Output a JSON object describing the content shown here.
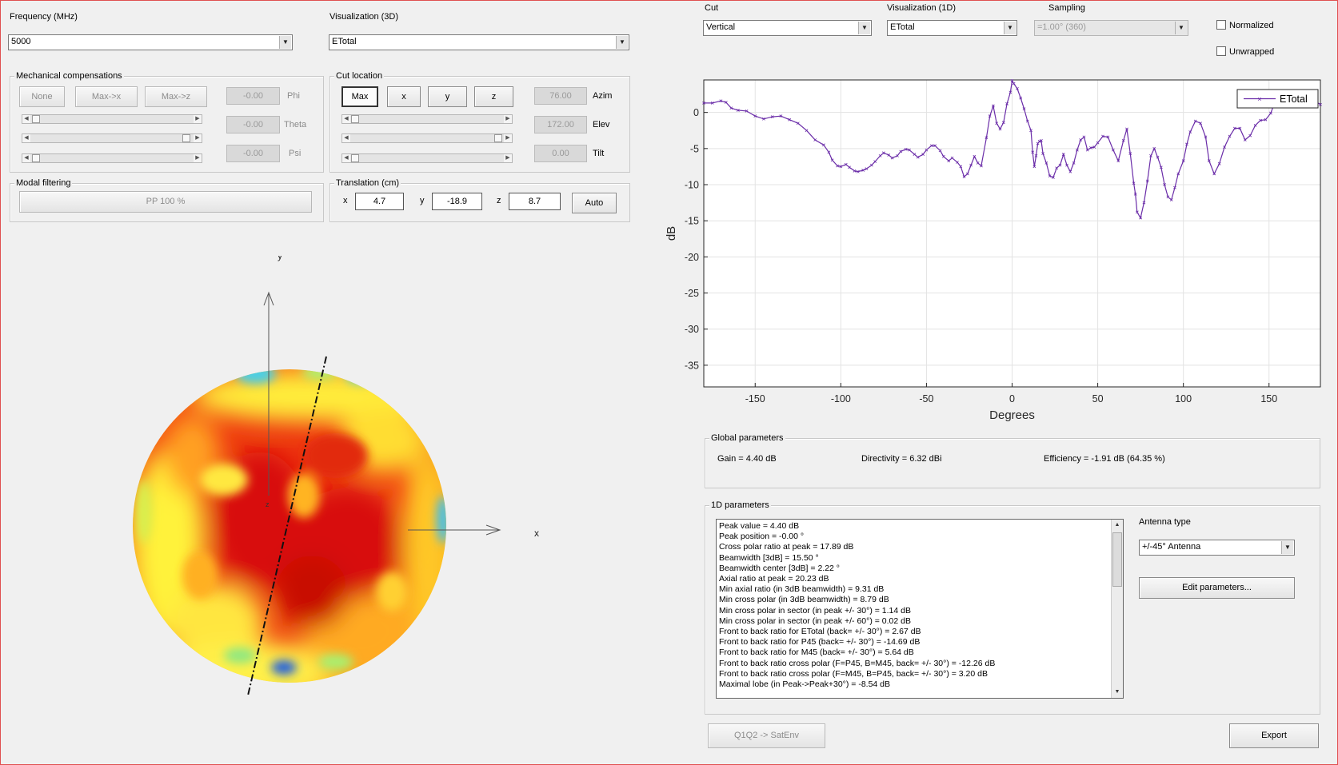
{
  "left": {
    "frequency": {
      "label": "Frequency (MHz)",
      "value": "5000"
    },
    "viz3d": {
      "label": "Visualization (3D)",
      "value": "ETotal"
    },
    "mech": {
      "title": "Mechanical compensations",
      "buttons": [
        "None",
        "Max->x",
        "Max->z"
      ],
      "fields": [
        {
          "value": "-0.00",
          "label": "Phi"
        },
        {
          "value": "-0.00",
          "label": "Theta"
        },
        {
          "value": "-0.00",
          "label": "Psi"
        }
      ]
    },
    "cutloc": {
      "title": "Cut location",
      "buttons": [
        "Max",
        "x",
        "y",
        "z"
      ],
      "fields": [
        {
          "value": "76.00",
          "label": "Azim"
        },
        {
          "value": "172.00",
          "label": "Elev"
        },
        {
          "value": "0.00",
          "label": "Tilt"
        }
      ]
    },
    "modal": {
      "title": "Modal filtering",
      "button": "PP 100 %"
    },
    "translation": {
      "title": "Translation (cm)",
      "x_label": "x",
      "x": "4.7",
      "y_label": "y",
      "y": "-18.9",
      "z_label": "z",
      "z": "8.7",
      "auto": "Auto"
    },
    "sphere_axes": {
      "y": "y",
      "x": "x",
      "z": "z"
    }
  },
  "right": {
    "cut": {
      "label": "Cut",
      "value": "Vertical"
    },
    "viz1d": {
      "label": "Visualization (1D)",
      "value": "ETotal"
    },
    "sampling": {
      "label": "Sampling",
      "value": "=1.00° (360)"
    },
    "normalized": {
      "label": "Normalized",
      "checked": false
    },
    "unwrapped": {
      "label": "Unwrapped",
      "checked": false
    },
    "global": {
      "title": "Global parameters",
      "gain": "Gain = 4.40 dB",
      "directivity": "Directivity = 6.32 dBi",
      "efficiency": "Efficiency = -1.91 dB  (64.35 %)"
    },
    "params1d": {
      "title": "1D parameters",
      "lines": [
        "Peak value = 4.40 dB",
        "Peak position = -0.00 °",
        "Cross polar ratio at peak = 17.89 dB",
        "Beamwidth [3dB] = 15.50 °",
        "Beamwidth center [3dB] = 2.22 °",
        "Axial ratio at peak = 20.23 dB",
        "Min axial ratio (in 3dB beamwidth) = 9.31 dB",
        "Min cross polar (in 3dB beamwidth) = 8.79 dB",
        "Min cross polar in sector (in peak +/- 30°) = 1.14 dB",
        "Min cross polar in sector (in peak +/- 60°) = 0.02 dB",
        "Front to back ratio for ETotal (back= +/- 30°) = 2.67 dB",
        "Front to back ratio for P45 (back= +/- 30°) = -14.69 dB",
        "Front to back ratio for M45 (back= +/- 30°) = 5.64 dB",
        "Front to back ratio cross polar (F=P45, B=M45, back= +/- 30°) = -12.26 dB",
        "Front to back ratio cross polar (F=M45, B=P45, back= +/- 30°) = 3.20 dB",
        "Maximal lobe (in Peak->Peak+30°) = -8.54 dB"
      ],
      "antenna_label": "Antenna type",
      "antenna_value": "+/-45° Antenna",
      "edit_button": "Edit parameters..."
    },
    "satenv_button": "Q1Q2 -> SatEnv",
    "export_button": "Export"
  },
  "chart_data": {
    "type": "line",
    "xlabel": "Degrees",
    "ylabel": "dB",
    "xlim": [
      -180,
      180
    ],
    "ylim": [
      -38,
      4.5
    ],
    "xticks": [
      -150,
      -100,
      -50,
      0,
      50,
      100,
      150
    ],
    "yticks": [
      0,
      -5,
      -10,
      -15,
      -20,
      -25,
      -30,
      -35
    ],
    "grid": true,
    "legend": "top-right",
    "series": [
      {
        "name": "ETotal",
        "color": "#6a2ca8",
        "x": [
          -180,
          -175,
          -170,
          -167,
          -164,
          -160,
          -155,
          -150,
          -145,
          -140,
          -135,
          -130,
          -125,
          -120,
          -115,
          -110,
          -107,
          -105,
          -102,
          -100,
          -97,
          -95,
          -92,
          -90,
          -87,
          -85,
          -82,
          -80,
          -77,
          -75,
          -72,
          -70,
          -67,
          -65,
          -62,
          -60,
          -57,
          -55,
          -52,
          -50,
          -47,
          -45,
          -42,
          -40,
          -37,
          -35,
          -32,
          -30,
          -28,
          -26,
          -24,
          -22,
          -20,
          -18,
          -15,
          -13,
          -11,
          -9,
          -7,
          -5,
          -3,
          -1,
          0,
          1,
          3,
          5,
          7,
          9,
          11,
          12,
          13,
          14,
          15,
          16,
          17,
          18,
          20,
          22,
          24,
          26,
          28,
          30,
          32,
          34,
          36,
          38,
          40,
          42,
          44,
          46,
          48,
          50,
          53,
          56,
          59,
          62,
          65,
          67,
          69,
          71,
          72,
          73,
          75,
          77,
          79,
          81,
          83,
          85,
          87,
          89,
          91,
          93,
          95,
          97,
          100,
          102,
          104,
          107,
          110,
          113,
          115,
          118,
          121,
          124,
          127,
          130,
          133,
          136,
          139,
          142,
          145,
          148,
          151,
          154,
          157,
          160,
          163,
          166,
          169,
          172,
          175,
          178,
          180
        ],
        "y": [
          1.3,
          1.3,
          1.6,
          1.4,
          0.6,
          0.3,
          0.2,
          -0.5,
          -0.9,
          -0.6,
          -0.5,
          -1.0,
          -1.5,
          -2.5,
          -3.8,
          -4.5,
          -5.5,
          -6.6,
          -7.4,
          -7.5,
          -7.2,
          -7.6,
          -8.1,
          -8.2,
          -8.0,
          -7.8,
          -7.3,
          -6.8,
          -6.0,
          -5.6,
          -5.9,
          -6.3,
          -6.0,
          -5.4,
          -5.1,
          -5.2,
          -5.8,
          -6.2,
          -5.8,
          -5.2,
          -4.6,
          -4.6,
          -5.3,
          -6.1,
          -6.7,
          -6.3,
          -6.9,
          -7.5,
          -8.9,
          -8.5,
          -7.3,
          -6.1,
          -7.0,
          -7.4,
          -3.5,
          -0.5,
          0.9,
          -1.5,
          -2.3,
          -1.4,
          1.2,
          2.8,
          4.4,
          4.0,
          3.3,
          2.0,
          0.5,
          -1.2,
          -2.5,
          -5.5,
          -7.5,
          -6.0,
          -4.3,
          -4.0,
          -3.9,
          -5.7,
          -7.0,
          -8.8,
          -9.0,
          -7.7,
          -7.3,
          -5.8,
          -7.3,
          -8.2,
          -7.0,
          -5.2,
          -3.8,
          -3.4,
          -5.2,
          -4.9,
          -4.8,
          -4.2,
          -3.3,
          -3.4,
          -5.2,
          -6.7,
          -3.9,
          -2.3,
          -5.7,
          -9.8,
          -11.3,
          -13.8,
          -14.6,
          -12.5,
          -9.5,
          -6.0,
          -5.0,
          -6.2,
          -7.6,
          -10.0,
          -11.7,
          -12.1,
          -10.4,
          -8.5,
          -6.7,
          -4.4,
          -2.7,
          -1.2,
          -1.5,
          -3.4,
          -6.7,
          -8.5,
          -7.1,
          -4.8,
          -3.3,
          -2.2,
          -2.2,
          -3.8,
          -3.2,
          -1.8,
          -1.1,
          -1.0,
          -0.1,
          1.8,
          2.4,
          1.3,
          0.8,
          0.9,
          1.6,
          1.3,
          0.9,
          1.4,
          1.1
        ]
      }
    ]
  }
}
